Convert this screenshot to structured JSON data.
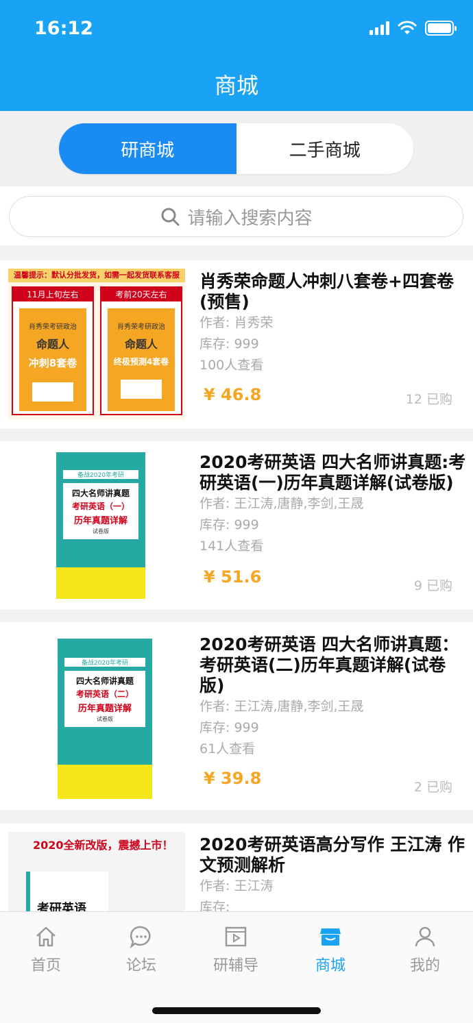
{
  "status": {
    "time": "16:12"
  },
  "header": {
    "title": "商城"
  },
  "segments": {
    "new": "研商城",
    "used": "二手商城"
  },
  "search": {
    "placeholder": "请输入搜索内容"
  },
  "products": [
    {
      "name": "肖秀荣命题人冲刺八套卷+四套卷(预售)",
      "author": "作者: 肖秀荣",
      "stock": "库存: 999",
      "views": "100人查看",
      "price": "¥ 46.8",
      "sold": "12 已购",
      "cover": {
        "notice": "温馨提示：默认分批发货，如需一起发货联系客服",
        "left_tag": "11月上旬左右",
        "right_tag": "考前20天左右",
        "left_book_title": "肖秀荣考研政治",
        "left_book_sub": "命题人",
        "left_book_big": "冲刺8套卷",
        "right_book_title": "肖秀荣考研政治",
        "right_book_sub": "命题人",
        "right_book_big": "终极预测4套卷"
      }
    },
    {
      "name": "2020考研英语 四大名师讲真题:考研英语(一)历年真题详解(试卷版)",
      "author": "作者: 王江涛,唐静,李剑,王晟",
      "stock": "库存: 999",
      "views": "141人查看",
      "price": "¥ 51.6",
      "sold": "9 已购",
      "cover": {
        "tag": "备战2020年考研",
        "title": "四大名师讲真题",
        "sub": "考研英语（一）",
        "big": "历年真题详解",
        "note": "试卷版"
      }
    },
    {
      "name": "2020考研英语 四大名师讲真题：考研英语(二)历年真题详解(试卷版)",
      "author": "作者: 王江涛,唐静,李剑,王晟",
      "stock": "库存: 999",
      "views": "61人查看",
      "price": "¥ 39.8",
      "sold": "2 已购",
      "cover": {
        "tag": "备战2020年考研",
        "title": "四大名师讲真题",
        "sub": "考研英语（二）",
        "big": "历年真题详解",
        "note": "试卷版"
      }
    },
    {
      "name": "2020考研英语高分写作 王江涛 作文预测解析",
      "author": "作者: 王江涛",
      "stock": "库存:",
      "cover": {
        "banner": "2020全新改版，震撼上市！",
        "book": "考研英语"
      }
    }
  ],
  "tabs": {
    "home": "首页",
    "forum": "论坛",
    "tutor": "研辅导",
    "mall": "商城",
    "mine": "我的"
  },
  "colors": {
    "primary": "#1aa3f5",
    "price": "#f5a623"
  }
}
